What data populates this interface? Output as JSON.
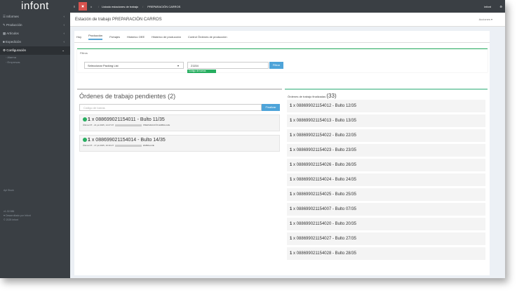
{
  "app": {
    "logo": "infont",
    "user": "infont"
  },
  "breadcrumb": {
    "item1": "Listado estaciones de trabajo",
    "item2": "PREPARACIÓN CARROS"
  },
  "sidebar": {
    "items": [
      {
        "label": "Informes",
        "arrow": "‹"
      },
      {
        "label": "Producción",
        "arrow": "‹"
      },
      {
        "label": "Artículos",
        "arrow": "‹"
      },
      {
        "label": "Expedición",
        "arrow": "‹"
      },
      {
        "label": "Configuración",
        "arrow": "⌄"
      }
    ],
    "subitems": [
      "Alarma",
      "Empresas"
    ],
    "footer": {
      "line0": "Apl Stock",
      "line1": "v1.32.986",
      "line2": "Desarrollado por Infont",
      "line3": "2025 Infont"
    }
  },
  "page": {
    "title": "Estación de trabajo PREPARACIÓN CARROS",
    "actions": "Acciones ▾"
  },
  "tabs": [
    "Hoy",
    "Producción",
    "Fichajes",
    "Histórico OEE",
    "Histórico de producción",
    "Control Órdenes de producción"
  ],
  "filters": {
    "label": "Filtros",
    "select_value": "Seleccionar Packing List",
    "code_value": "21154",
    "filter_btn": "Filtrar",
    "found_msg": "Código de barras encontrado"
  },
  "pending": {
    "title": "Órdenes de trabajo pendientes (2)",
    "barcode_placeholder": "Código de barras",
    "finish_btn": "Finalizar",
    "orders": [
      {
        "qty": "1",
        "text": " x 088699021154011 - Bulto 11/35",
        "meta": "Última OT - 21 jul 2025, 14:47:07",
        "type": "PREPARACIÓN EMBALAJE"
      },
      {
        "qty": "1",
        "text": " x 088699021154014 - Bulto 14/35",
        "meta": "Última OT - 17 jul 2025, 19:16:27",
        "type": "EMBALAJE"
      }
    ]
  },
  "finished": {
    "label": "Órdenes de trabajo finalizadas",
    "count": "(33)",
    "rows": [
      {
        "qty": "1",
        "text": " x 088699021154012 - Bulto 12/35"
      },
      {
        "qty": "1",
        "text": " x 088699021154013 - Bulto 13/35"
      },
      {
        "qty": "1",
        "text": " x 088699021154022 - Bulto 22/35"
      },
      {
        "qty": "1",
        "text": " x 088699021154023 - Bulto 23/35"
      },
      {
        "qty": "1",
        "text": " x 088699021154026 - Bulto 26/35"
      },
      {
        "qty": "1",
        "text": " x 088699021154024 - Bulto 24/35"
      },
      {
        "qty": "1",
        "text": " x 088699021154025 - Bulto 25/35"
      },
      {
        "qty": "1",
        "text": " x 088699021154007 - Bulto 07/35"
      },
      {
        "qty": "1",
        "text": " x 088699021154020 - Bulto 20/35"
      },
      {
        "qty": "1",
        "text": " x 088699021154027 - Bulto 27/35"
      },
      {
        "qty": "1",
        "text": " x 088699021154028 - Bulto 28/35"
      }
    ]
  }
}
